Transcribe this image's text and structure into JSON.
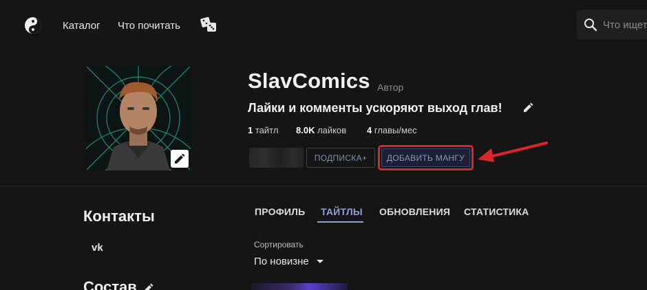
{
  "nav": {
    "catalog": "Каталог",
    "what_to_read": "Что почитать",
    "search_placeholder": "Что ищете?"
  },
  "profile": {
    "username": "SlavComics",
    "role": "Автор",
    "status": "Лайки и комменты ускоряют выход глав!",
    "stats": {
      "titles_count": "1",
      "titles_label": "тайтл",
      "likes_count": "8.0K",
      "likes_label": "лайков",
      "chapters_count": "4",
      "chapters_label": "главы/мес"
    },
    "subscribe_label": "ПОДПИСКА+",
    "add_manga_label": "ДОБАВИТЬ МАНГУ"
  },
  "sidebar": {
    "contacts_title": "Контакты",
    "vk_label": "vk",
    "staff_title": "Состав"
  },
  "tabs": [
    {
      "label": "ПРОФИЛЬ",
      "active": false
    },
    {
      "label": "ТАЙТЛЫ",
      "active": true
    },
    {
      "label": "ОБНОВЛЕНИЯ",
      "active": false
    },
    {
      "label": "СТАТИСТИКА",
      "active": false
    }
  ],
  "sort": {
    "label": "Сортировать",
    "value": "По новизне"
  },
  "colors": {
    "background": "#151515",
    "accent": "#8fa0d8",
    "highlight": "#d8262d"
  },
  "icons": [
    "yin-yang-logo-icon",
    "dice-icon",
    "search-icon",
    "pencil-icon",
    "vk-icon",
    "chevron-down-icon",
    "red-arrow-annotation"
  ]
}
